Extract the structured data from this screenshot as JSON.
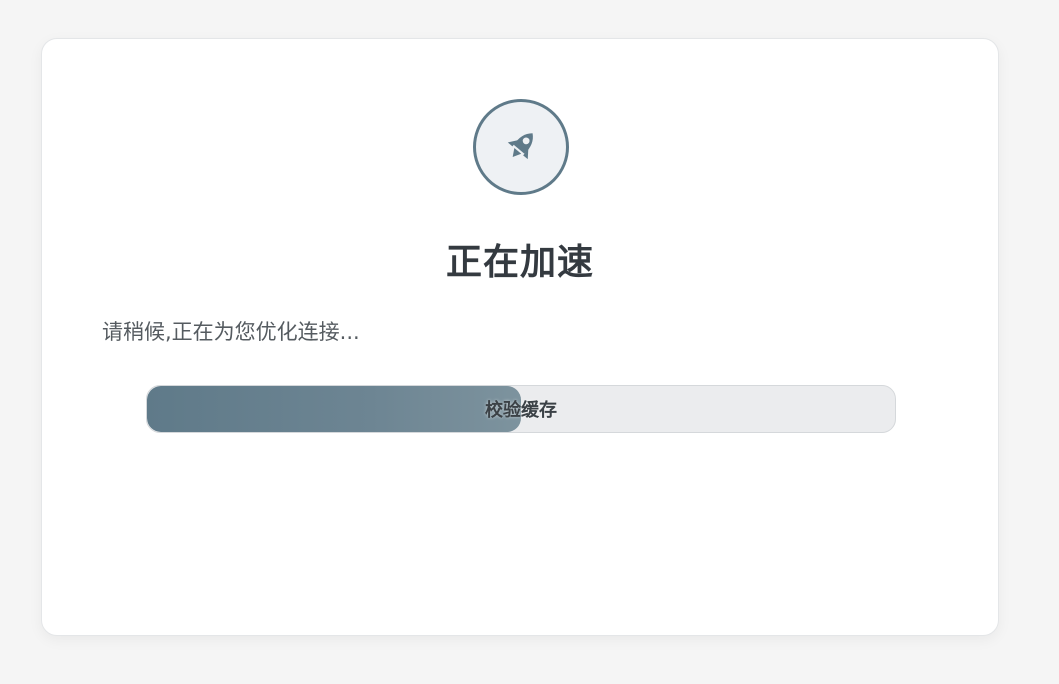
{
  "card": {
    "icon": "rocket-icon",
    "title": "正在加速",
    "subtitle": "请稍候,正在为您优化连接..."
  },
  "progress": {
    "label": "校验缓存",
    "percent": 50
  },
  "colors": {
    "accent": "#5f7a89",
    "title": "#343a40",
    "background": "#f5f5f5"
  }
}
